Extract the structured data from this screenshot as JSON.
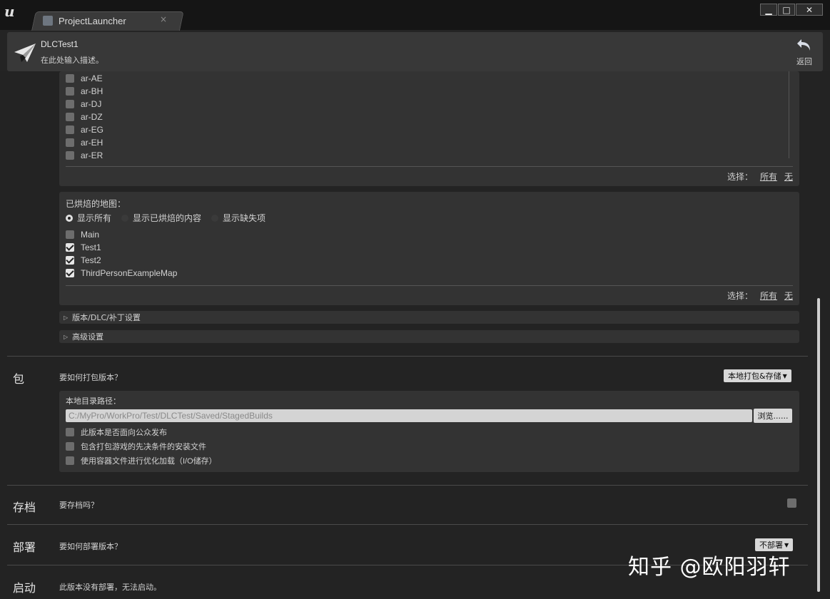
{
  "window": {
    "tab_title": "ProjectLauncher",
    "tab_close": "×",
    "minimize": "▁",
    "maximize": "□",
    "close": "✕"
  },
  "header": {
    "project_name": "DLCTest1",
    "description": "在此处输入描述。",
    "back_label": "返回"
  },
  "cultures": {
    "items": [
      {
        "label": "ar-AE",
        "checked": false
      },
      {
        "label": "ar-BH",
        "checked": false
      },
      {
        "label": "ar-DJ",
        "checked": false
      },
      {
        "label": "ar-DZ",
        "checked": false
      },
      {
        "label": "ar-EG",
        "checked": false
      },
      {
        "label": "ar-EH",
        "checked": false
      },
      {
        "label": "ar-ER",
        "checked": false
      }
    ],
    "select_label": "选择：",
    "select_all": "所有",
    "select_none": "无"
  },
  "maps": {
    "title": "已烘焙的地图：",
    "radio_options": [
      {
        "label": "显示所有",
        "selected": true
      },
      {
        "label": "显示已烘焙的内容",
        "selected": false
      },
      {
        "label": "显示缺失项",
        "selected": false
      }
    ],
    "items": [
      {
        "label": "Main",
        "checked": false
      },
      {
        "label": "Test1",
        "checked": true
      },
      {
        "label": "Test2",
        "checked": true
      },
      {
        "label": "ThirdPersonExampleMap",
        "checked": true
      }
    ],
    "select_label": "选择：",
    "select_all": "所有",
    "select_none": "无"
  },
  "collapsibles": {
    "release_label": "版本/DLC/补丁设置",
    "advanced_label": "高级设置"
  },
  "package": {
    "section_label": "包",
    "question": "要如何打包版本？",
    "mode_button": "本地打包&存储",
    "dir_label": "本地目录路径：",
    "dir_value": "C:/MyPro/WorkPro/Test/DLCTest/Saved/StagedBuilds",
    "browse_button": "浏览......",
    "options": [
      {
        "label": "此版本是否面向公众发布",
        "checked": false
      },
      {
        "label": "包含打包游戏的先决条件的安装文件",
        "checked": false
      },
      {
        "label": "使用容器文件进行优化加载（I/O储存）",
        "checked": false
      }
    ]
  },
  "archive": {
    "section_label": "存档",
    "question": "要存档吗？"
  },
  "deploy": {
    "section_label": "部署",
    "question": "要如何部署版本？",
    "mode_button": "不部署"
  },
  "launch": {
    "section_label": "启动",
    "message": "此版本没有部署，无法启动。"
  },
  "watermark": "知乎 @欧阳羽轩"
}
